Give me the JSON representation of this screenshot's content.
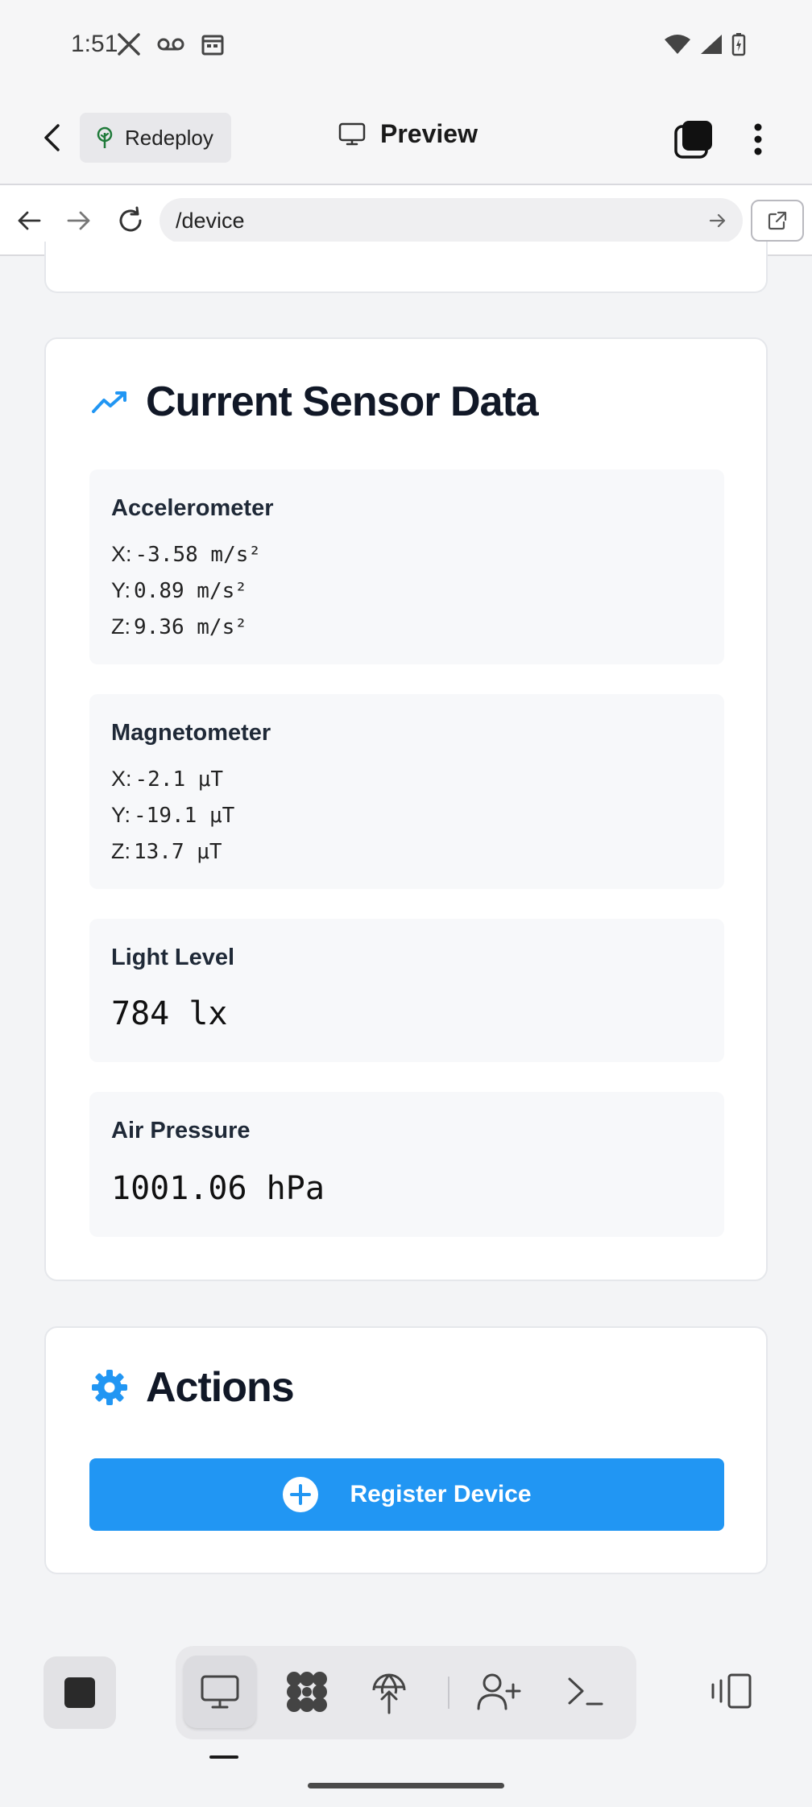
{
  "status_bar": {
    "time": "1:51",
    "left_icons": [
      "x-logo-icon",
      "voicemail-icon",
      "calendar-icon"
    ],
    "right_icons": [
      "wifi-icon",
      "signal-icon",
      "battery-charging-icon"
    ]
  },
  "app_bar": {
    "redeploy_label": "Redeploy",
    "title": "Preview"
  },
  "url_bar": {
    "url": "/device"
  },
  "sensor_card": {
    "heading": "Current Sensor Data",
    "accelerometer": {
      "title": "Accelerometer",
      "x_label": "X:",
      "x_value": "-3.58 m/s²",
      "y_label": "Y:",
      "y_value": "0.89 m/s²",
      "z_label": "Z:",
      "z_value": "9.36 m/s²"
    },
    "magnetometer": {
      "title": "Magnetometer",
      "x_label": "X:",
      "x_value": "-2.1 μT",
      "y_label": "Y:",
      "y_value": "-19.1 μT",
      "z_label": "Z:",
      "z_value": "13.7 μT"
    },
    "light": {
      "title": "Light Level",
      "value": "784 lx"
    },
    "pressure": {
      "title": "Air Pressure",
      "value": "1001.06 hPa"
    }
  },
  "actions_card": {
    "heading": "Actions",
    "register_label": "Register Device"
  },
  "colors": {
    "accent": "#2196f3",
    "tile_bg": "#f7f8fa",
    "page_bg": "#f3f4f6"
  }
}
